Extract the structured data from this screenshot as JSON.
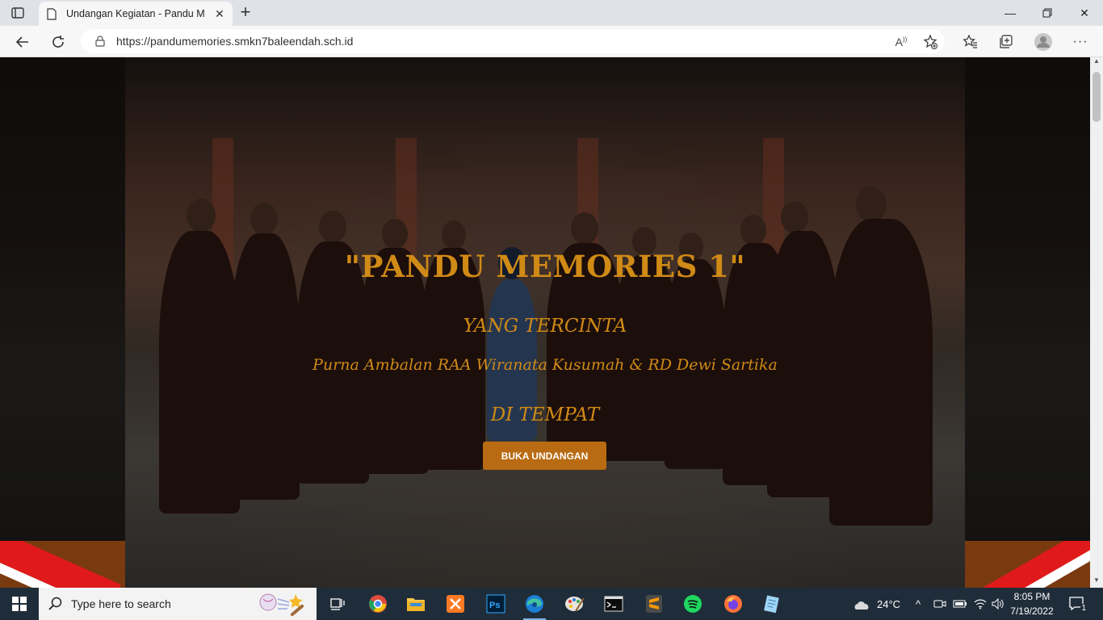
{
  "browser": {
    "tab_title": "Undangan Kegiatan - Pandu Me",
    "url": "https://pandumemories.smkn7baleendah.sch.id"
  },
  "page": {
    "headline": "\"PANDU MEMORIES 1\"",
    "subtitle_1": "YANG TERCINTA",
    "subtitle_2": "Purna Ambalan RAA Wiranata Kusumah & RD Dewi Sartika",
    "subtitle_3": "DI TEMPAT",
    "open_button": "BUKA UNDANGAN",
    "accent_color": "#d08a16",
    "button_color": "#b86b12"
  },
  "taskbar": {
    "search_placeholder": "Type here to search",
    "weather": "24°C",
    "time": "8:05 PM",
    "date": "7/19/2022",
    "notification_count": "1"
  }
}
